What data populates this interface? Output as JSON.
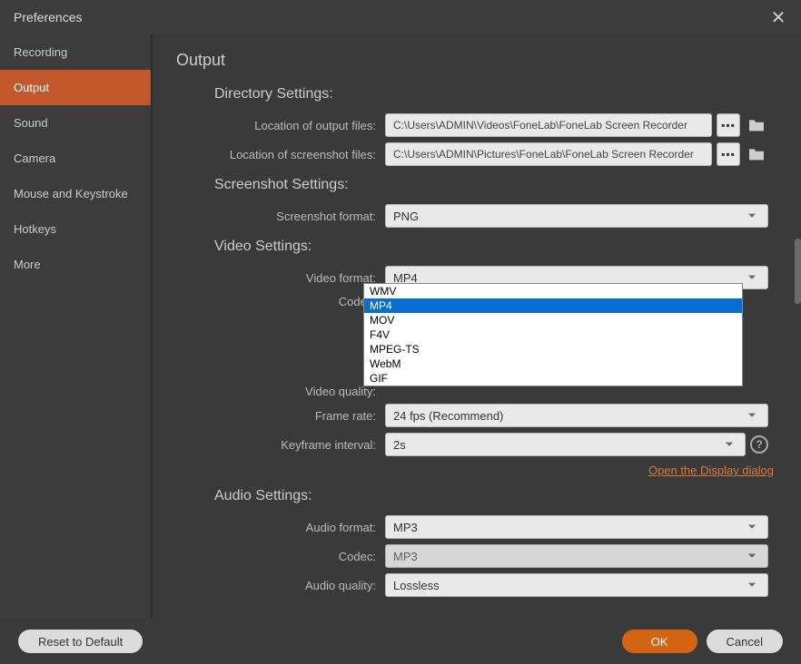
{
  "window": {
    "title": "Preferences"
  },
  "sidebar": {
    "items": [
      {
        "label": "Recording"
      },
      {
        "label": "Output"
      },
      {
        "label": "Sound"
      },
      {
        "label": "Camera"
      },
      {
        "label": "Mouse and Keystroke"
      },
      {
        "label": "Hotkeys"
      },
      {
        "label": "More"
      }
    ]
  },
  "page": {
    "title": "Output"
  },
  "sections": {
    "directory": {
      "title": "Directory Settings:",
      "output_label": "Location of output files:",
      "output_path": "C:\\Users\\ADMIN\\Videos\\FoneLab\\FoneLab Screen Recorder",
      "screenshot_label": "Location of screenshot files:",
      "screenshot_path": "C:\\Users\\ADMIN\\Pictures\\FoneLab\\FoneLab Screen Recorder"
    },
    "screenshot": {
      "title": "Screenshot Settings:",
      "format_label": "Screenshot format:",
      "format_value": "PNG"
    },
    "video": {
      "title": "Video Settings:",
      "format_label": "Video format:",
      "format_value": "MP4",
      "format_options": [
        "WMV",
        "MP4",
        "MOV",
        "F4V",
        "MPEG-TS",
        "WebM",
        "GIF"
      ],
      "codec_label": "Codec:",
      "quality_label": "Video quality:",
      "framerate_label": "Frame rate:",
      "framerate_value": "24 fps (Recommend)",
      "keyframe_label": "Keyframe interval:",
      "keyframe_value": "2s",
      "link": "Open the Display dialog"
    },
    "audio": {
      "title": "Audio Settings:",
      "format_label": "Audio format:",
      "format_value": "MP3",
      "codec_label": "Codec:",
      "codec_value": "MP3",
      "quality_label": "Audio quality:",
      "quality_value": "Lossless"
    }
  },
  "footer": {
    "reset": "Reset to Default",
    "ok": "OK",
    "cancel": "Cancel"
  },
  "icons": {
    "ellipsis": "▪▪▪",
    "help": "?"
  }
}
